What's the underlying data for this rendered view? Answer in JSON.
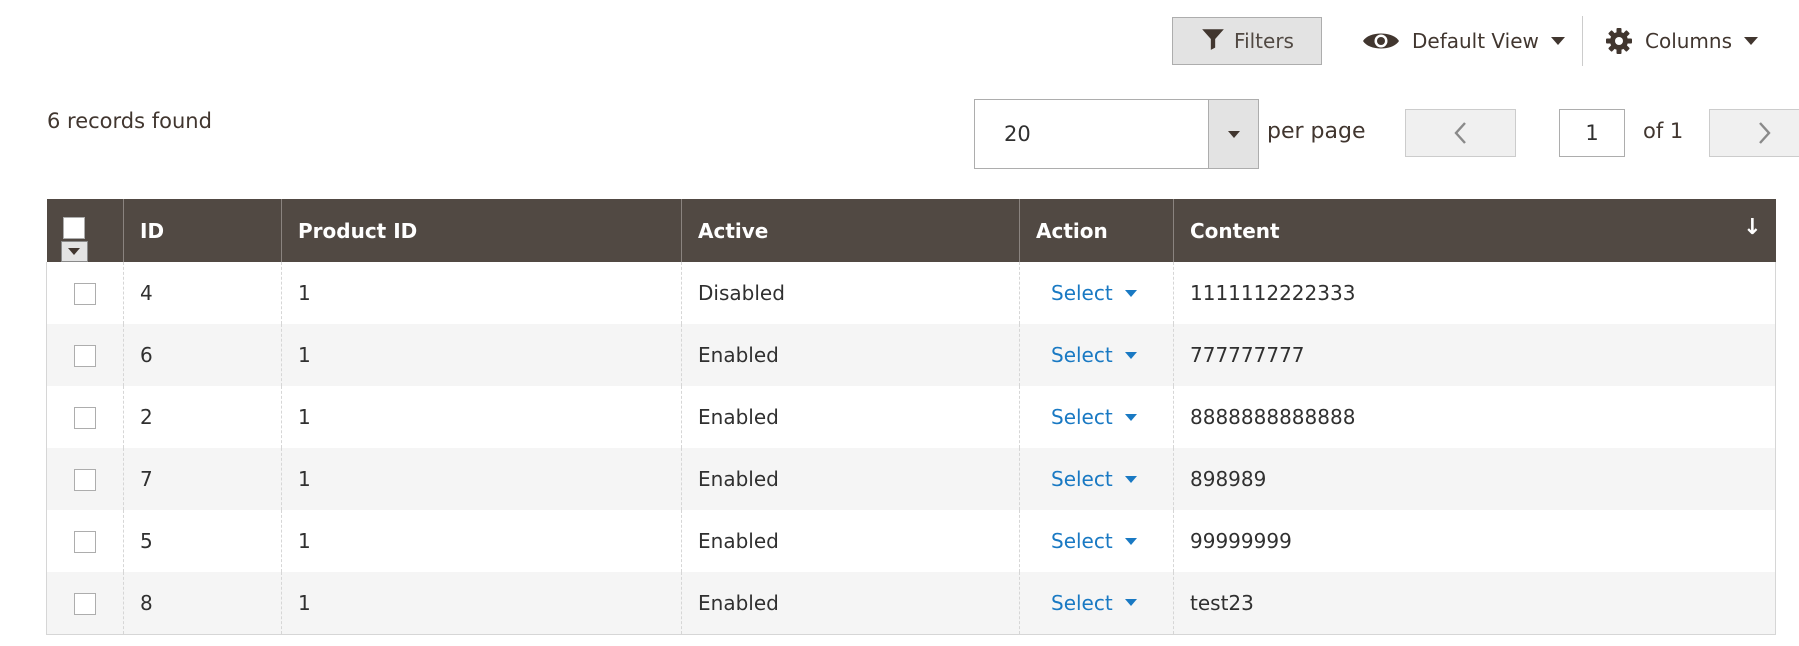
{
  "toolbar": {
    "filters_label": "Filters",
    "view_label": "Default View",
    "columns_label": "Columns"
  },
  "pager": {
    "records_text": "6 records found",
    "per_page_value": "20",
    "per_page_label": "per page",
    "current_page": "1",
    "of_text": "of 1"
  },
  "grid": {
    "headers": [
      "ID",
      "Product ID",
      "Active",
      "Action",
      "Content"
    ],
    "sort_indicator": "↓",
    "action_label": "Select",
    "rows": [
      {
        "id": "4",
        "product_id": "1",
        "active": "Disabled",
        "content": "1111112222333"
      },
      {
        "id": "6",
        "product_id": "1",
        "active": "Enabled",
        "content": "777777777"
      },
      {
        "id": "2",
        "product_id": "1",
        "active": "Enabled",
        "content": "8888888888888"
      },
      {
        "id": "7",
        "product_id": "1",
        "active": "Enabled",
        "content": "898989"
      },
      {
        "id": "5",
        "product_id": "1",
        "active": "Enabled",
        "content": "99999999"
      },
      {
        "id": "8",
        "product_id": "1",
        "active": "Enabled",
        "content": "test23"
      }
    ]
  },
  "icons": {
    "filters": "funnel-icon",
    "view": "eye-icon",
    "columns": "gear-icon",
    "prev": "chevron-left-icon",
    "next": "chevron-right-icon"
  },
  "colors": {
    "header_bg": "#514943",
    "link": "#1979c3",
    "button_bg": "#e3e3e3"
  }
}
